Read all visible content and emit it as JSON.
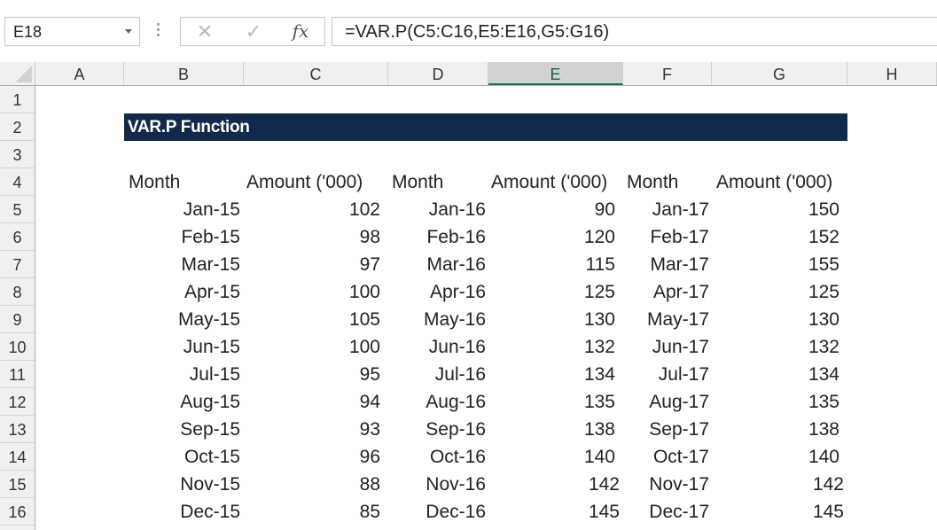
{
  "name_box": {
    "value": "E18"
  },
  "formula_bar": {
    "cancel_glyph": "✕",
    "enter_glyph": "✓",
    "insert_function_label": "fx",
    "formula": "=VAR.P(C5:C16,E5:E16,G5:G16)"
  },
  "columns": [
    "A",
    "B",
    "C",
    "D",
    "E",
    "F",
    "G",
    "H"
  ],
  "selected_column": "E",
  "rows": [
    "1",
    "2",
    "3",
    "4",
    "5",
    "6",
    "7",
    "8",
    "9",
    "10",
    "11",
    "12",
    "13",
    "14",
    "15",
    "16"
  ],
  "sheet": {
    "title": "VAR.P Function",
    "headers": {
      "b": "Month",
      "c": "Amount ('000)",
      "d": "Month",
      "e": "Amount ('000)",
      "f": "Month",
      "g": "Amount ('000)"
    },
    "data": [
      {
        "b": "Jan-15",
        "c": "102",
        "d": "Jan-16",
        "e": "90",
        "f": "Jan-17",
        "g": "150"
      },
      {
        "b": "Feb-15",
        "c": "98",
        "d": "Feb-16",
        "e": "120",
        "f": "Feb-17",
        "g": "152"
      },
      {
        "b": "Mar-15",
        "c": "97",
        "d": "Mar-16",
        "e": "115",
        "f": "Mar-17",
        "g": "155"
      },
      {
        "b": "Apr-15",
        "c": "100",
        "d": "Apr-16",
        "e": "125",
        "f": "Apr-17",
        "g": "125"
      },
      {
        "b": "May-15",
        "c": "105",
        "d": "May-16",
        "e": "130",
        "f": "May-17",
        "g": "130"
      },
      {
        "b": "Jun-15",
        "c": "100",
        "d": "Jun-16",
        "e": "132",
        "f": "Jun-17",
        "g": "132"
      },
      {
        "b": "Jul-15",
        "c": "95",
        "d": "Jul-16",
        "e": "134",
        "f": "Jul-17",
        "g": "134"
      },
      {
        "b": "Aug-15",
        "c": "94",
        "d": "Aug-16",
        "e": "135",
        "f": "Aug-17",
        "g": "135"
      },
      {
        "b": "Sep-15",
        "c": "93",
        "d": "Sep-16",
        "e": "138",
        "f": "Sep-17",
        "g": "138"
      },
      {
        "b": "Oct-15",
        "c": "96",
        "d": "Oct-16",
        "e": "140",
        "f": "Oct-17",
        "g": "140"
      },
      {
        "b": "Nov-15",
        "c": "88",
        "d": "Nov-16",
        "e": "142",
        "f": "Nov-17",
        "g": "142"
      },
      {
        "b": "Dec-15",
        "c": "85",
        "d": "Dec-16",
        "e": "145",
        "f": "Dec-17",
        "g": "145"
      }
    ]
  },
  "colors": {
    "title_fill": "#13294b",
    "title_text": "#ffffff",
    "selected_header_accent": "#217346"
  }
}
